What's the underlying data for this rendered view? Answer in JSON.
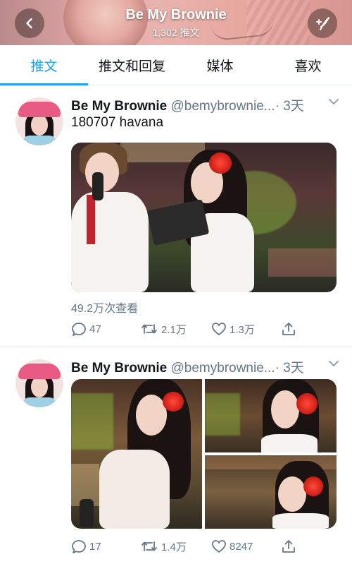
{
  "header": {
    "title": "Be My Brownie",
    "subtitle": "1,302 推文"
  },
  "tabs": [
    {
      "label": "推文",
      "active": true
    },
    {
      "label": "推文和回复",
      "active": false
    },
    {
      "label": "媒体",
      "active": false
    },
    {
      "label": "喜欢",
      "active": false
    }
  ],
  "colors": {
    "accent": "#1da1f2",
    "text": "#14171a",
    "muted": "#657786",
    "divider": "#e1e8ed"
  },
  "tweets": [
    {
      "name": "Be My Brownie",
      "handle": "@bemybrownie...",
      "time": "· 3天",
      "text": "180707 havana",
      "views": "49.2万次查看",
      "replies": "47",
      "retweets": "2.1万",
      "likes": "1.3万"
    },
    {
      "name": "Be My Brownie",
      "handle": "@bemybrownie...",
      "time": "· 3天",
      "text": "",
      "replies": "17",
      "retweets": "1.4万",
      "likes": "8247"
    }
  ],
  "icons": {
    "back": "back-arrow-icon",
    "compose": "compose-feather-icon",
    "caret": "chevron-down-icon",
    "reply": "reply-icon",
    "retweet": "retweet-icon",
    "like": "heart-icon",
    "share": "share-icon"
  }
}
